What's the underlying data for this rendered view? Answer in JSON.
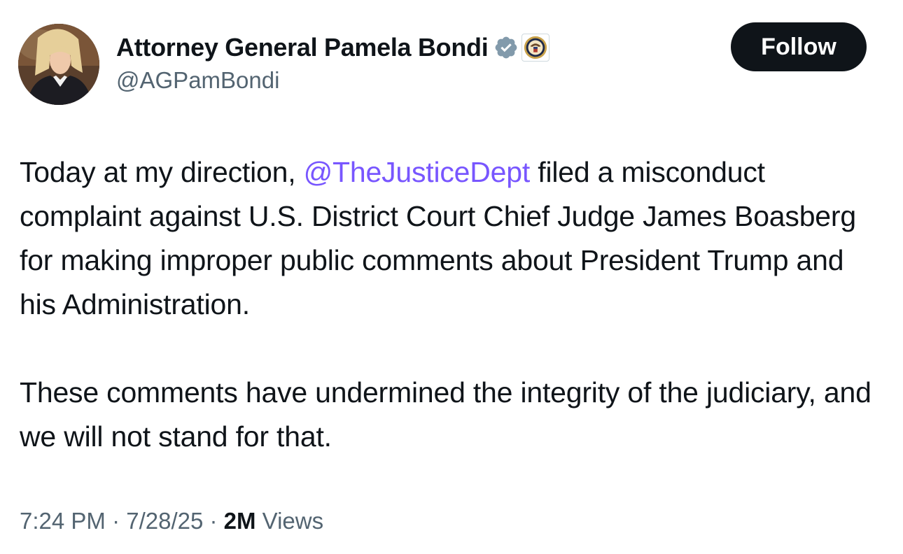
{
  "author": {
    "display_name": "Attorney General Pamela Bondi",
    "handle": "@AGPamBondi",
    "verified_badge_icon": "verified-badge-icon",
    "affiliate_icon": "department-of-justice-seal-icon"
  },
  "follow_button": {
    "label": "Follow"
  },
  "tweet": {
    "para1_before": "Today at my direction, ",
    "mention": "@TheJusticeDept",
    "para1_after": " filed a misconduct complaint against U.S. District Court Chief Judge James Boasberg for making improper public comments about President Trump and his Administration.",
    "para2": "These comments have undermined the integrity of the judiciary, and we will not stand for that."
  },
  "meta": {
    "time": "7:24 PM",
    "sep1": " · ",
    "date": "7/28/25",
    "sep2": " · ",
    "views_count": "2M",
    "views_label": " Views"
  },
  "colors": {
    "text": "#0f1419",
    "secondary": "#536471",
    "mention": "#7856ff",
    "verified_badge": "#829aab",
    "follow_bg": "#0f1419"
  }
}
